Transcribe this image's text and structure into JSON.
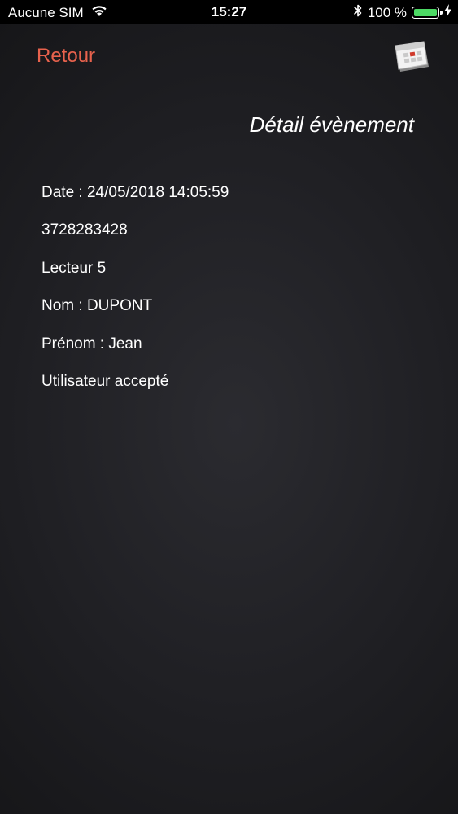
{
  "status_bar": {
    "carrier": "Aucune SIM",
    "time": "15:27",
    "battery_percent": "100 %",
    "battery_level": 1.0,
    "icons": [
      "wifi-icon",
      "bluetooth-icon",
      "battery-icon",
      "charging-bolt-icon"
    ],
    "battery_color": "#4cd964"
  },
  "nav": {
    "back_label": "Retour",
    "back_color": "#e8624d",
    "calendar_icon": "calendar-icon"
  },
  "page": {
    "title": "Détail évènement"
  },
  "details": [
    "Date : 24/05/2018 14:05:59",
    "3728283428",
    "Lecteur 5",
    "Nom : DUPONT",
    "Prénom : Jean",
    "Utilisateur accepté"
  ]
}
